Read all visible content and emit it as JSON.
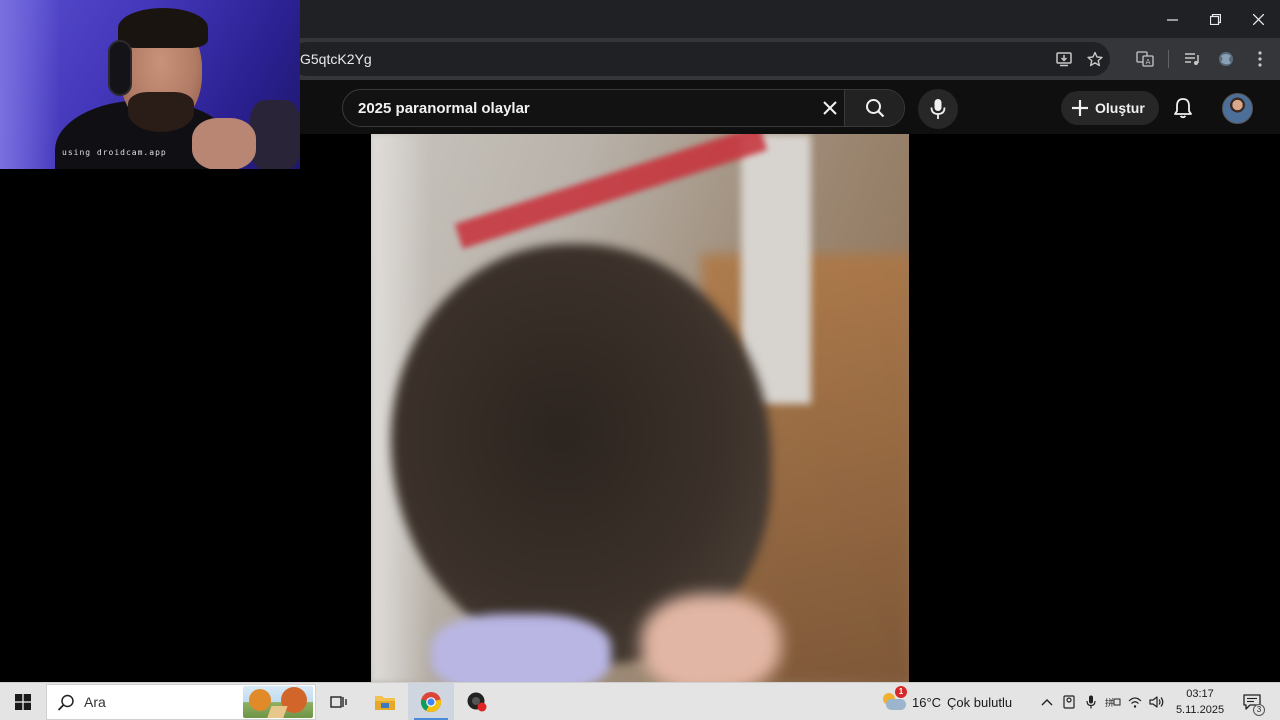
{
  "browser": {
    "url_fragment": "G5qtcK2Yg",
    "window_controls": {
      "minimize_icon": "minimize-icon",
      "restore_icon": "restore-icon",
      "close_icon": "close-icon"
    },
    "omnibox_icons": [
      "install-app-icon",
      "bookmark-star-icon"
    ],
    "extension_icons": [
      "translate-icon",
      "media-control-icon",
      "extension-icon",
      "menu-kebab-icon"
    ]
  },
  "youtube": {
    "search": {
      "value": "2025 paranormal olaylar",
      "clear_icon": "close-icon",
      "search_icon": "search-icon"
    },
    "mic_icon": "microphone-icon",
    "create_label": "Oluştur",
    "bell_icon": "bell-icon",
    "colors": {
      "header_bg": "#0f0f0f",
      "page_bg": "#000000",
      "chip_bg": "#272727"
    }
  },
  "webcam": {
    "watermark": "using droidcam.app"
  },
  "taskbar": {
    "search_placeholder": "Ara",
    "apps": [
      "task-view-icon",
      "file-explorer-icon",
      "chrome-icon",
      "recorder-app-icon"
    ],
    "weather": {
      "badge": "1",
      "temperature": "16°C",
      "condition": "Çok bulutlu"
    },
    "clock": {
      "time": "03:17",
      "date": "5.11.2025"
    },
    "notification_count": "3",
    "colors": {
      "bar_bg": "#e4e4e4",
      "active_indicator": "#4a8ad6"
    }
  }
}
